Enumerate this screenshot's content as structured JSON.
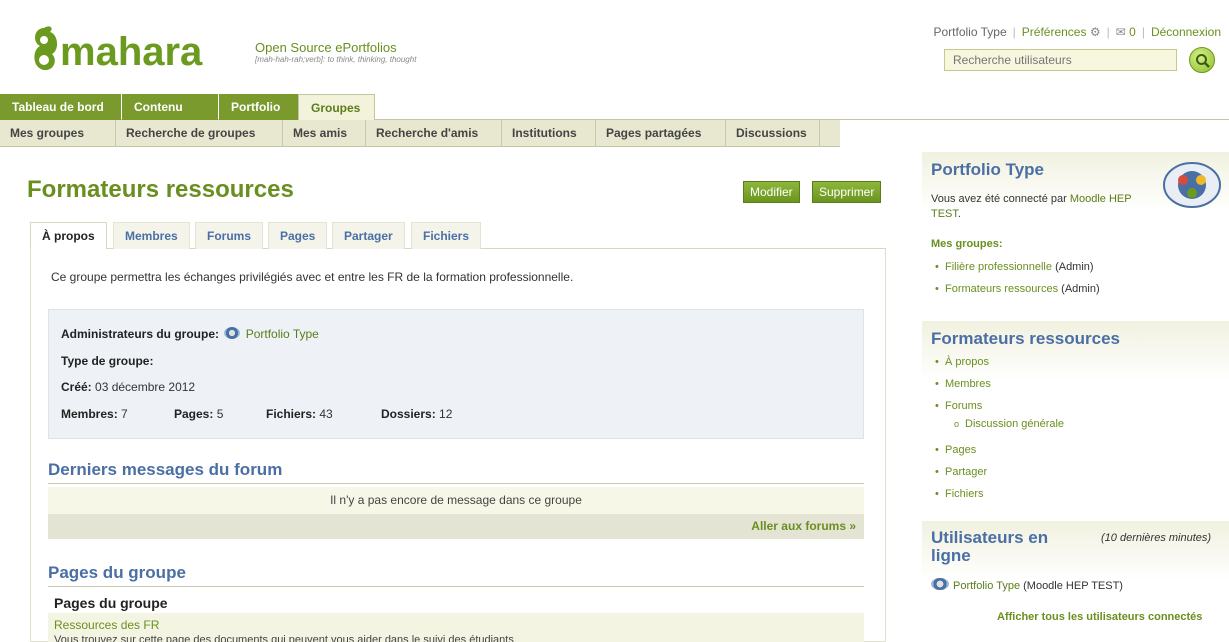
{
  "header": {
    "logo_text": "mahara",
    "tagline_title": "Open Source ePortfolios",
    "tagline_sub": "[mah-hah-rah;verb]: to think, thinking, thought",
    "toplinks": {
      "user": "Portfolio Type",
      "preferences": "Préférences",
      "inbox_count": "0",
      "logout": "Déconnexion"
    },
    "search_placeholder": "Recherche utilisateurs"
  },
  "mainnav": [
    "Tableau de bord",
    "Contenu",
    "Portfolio",
    "Groupes"
  ],
  "mainnav_active": "Groupes",
  "subnav": [
    "Mes groupes",
    "Recherche de groupes",
    "Mes amis",
    "Recherche d'amis",
    "Institutions",
    "Pages partagées",
    "Discussions"
  ],
  "group": {
    "title": "Formateurs ressources",
    "edit_label": "Modifier",
    "delete_label": "Supprimer",
    "tabs": [
      "À propos",
      "Membres",
      "Forums",
      "Pages",
      "Partager",
      "Fichiers"
    ],
    "description": "Ce groupe permettra les échanges privilégiés avec et entre les FR de la formation professionnelle.",
    "info": {
      "admins_label": "Administrateurs du groupe:",
      "admins_value": "Portfolio Type",
      "type_label": "Type de groupe:",
      "created_label": "Créé:",
      "created_value": "03 décembre 2012",
      "members_label": "Membres:",
      "members_value": "7",
      "pages_label": "Pages:",
      "pages_value": "5",
      "files_label": "Fichiers:",
      "files_value": "43",
      "folders_label": "Dossiers:",
      "folders_value": "12"
    },
    "forum_heading": "Derniers messages du forum",
    "forum_empty": "Il n'y a pas encore de message dans ce groupe",
    "forum_link": "Aller aux forums »",
    "pages_heading": "Pages du groupe",
    "pages_subheading": "Pages du groupe",
    "page_item_title": "Ressources des FR",
    "page_item_desc": "Vous trouvez sur cette page des documents qui peuvent vous aider dans le suivi des étudiants"
  },
  "sidebar": {
    "profile": {
      "name": "Portfolio Type",
      "connected_prefix": "Vous avez été connecté par",
      "connected_by_1": "Moodle HEP",
      "connected_by_2": "TEST",
      "my_groups_label": "Mes groupes:",
      "groups": [
        {
          "name": "Filière professionnelle",
          "role": "(Admin)"
        },
        {
          "name": "Formateurs ressources",
          "role": "(Admin)"
        }
      ]
    },
    "group_menu": {
      "title": "Formateurs ressources",
      "items": [
        "À propos",
        "Membres",
        "Forums",
        "Discussion générale",
        "Pages",
        "Partager",
        "Fichiers"
      ]
    },
    "online": {
      "title_1": "Utilisateurs en",
      "title_2": "ligne",
      "period": "(10 dernières minutes)",
      "user": "Portfolio Type",
      "user_inst": "(Moodle HEP TEST)",
      "show_all": "Afficher tous les utilisateurs connectés"
    }
  }
}
